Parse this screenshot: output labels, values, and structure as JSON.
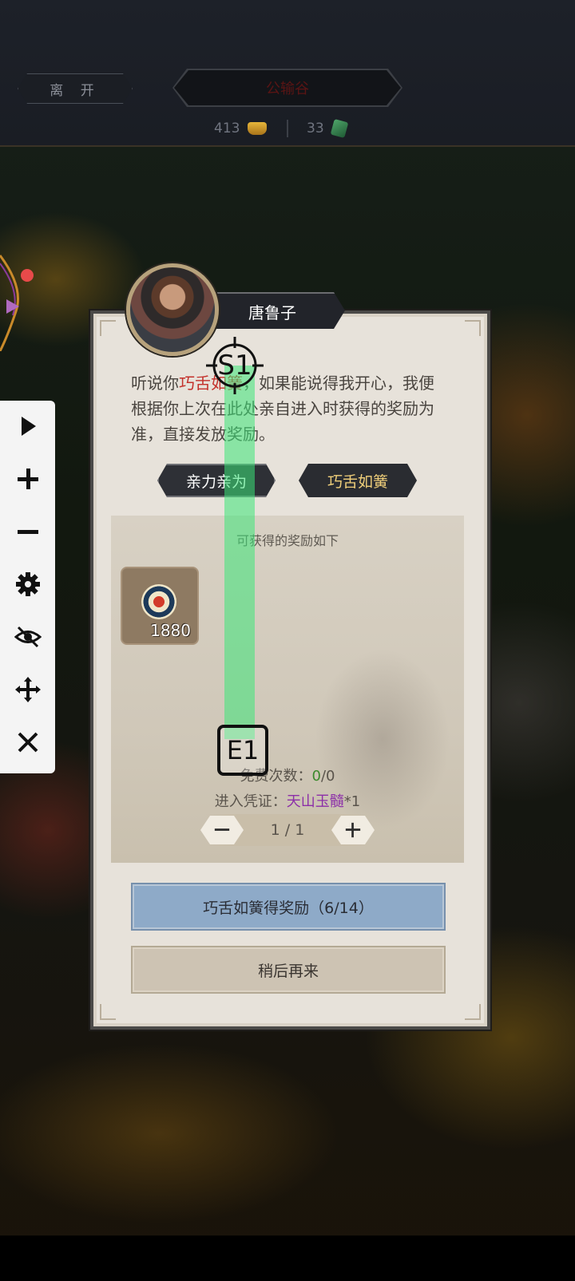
{
  "header": {
    "leave_label": "离 开",
    "location_name": "公输谷",
    "gold_amount": "413",
    "jade_amount": "33"
  },
  "toolbar": {
    "icons": [
      "play-icon",
      "plus-icon",
      "minus-icon",
      "gear-icon",
      "eye-off-icon",
      "move-icon",
      "close-icon"
    ]
  },
  "npc": {
    "name": "唐鲁子"
  },
  "dialog": {
    "text_before": "听说你",
    "text_highlight": "巧舌如簧",
    "text_after": "，如果能说得我开心，我便根据你上次在此处亲自进入时获得的奖励为准，直接发放奖励。",
    "choice_diligent": "亲力亲为",
    "choice_eloquent": "巧舌如簧"
  },
  "rewards": {
    "title": "可获得的奖励如下",
    "item_count": "1880",
    "free_label": "免费次数：",
    "free_used": "0",
    "free_total": "/0",
    "ticket_label": "进入凭证：",
    "ticket_name": "天山玉髓",
    "ticket_qty": "*1",
    "stepper_value": "1 / 1"
  },
  "actions": {
    "claim_label": "巧舌如簧得奖励（6/14）",
    "later_label": "稍后再来"
  },
  "overlay": {
    "start_marker": "S1",
    "end_marker": "E1"
  },
  "colors": {
    "highlight_red": "#c3302a",
    "free_green": "#3c8a2c",
    "ticket_purple": "#8c2fa8",
    "claim_blue": "#8eaac8",
    "swipe_green": "#3ce678"
  }
}
